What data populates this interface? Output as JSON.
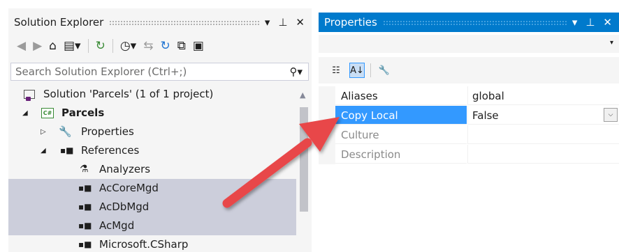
{
  "solution_explorer": {
    "title": "Solution Explorer",
    "title_buttons": {
      "dropdown": "▾",
      "pin": "⊥",
      "close": "✕"
    },
    "search": {
      "placeholder": "Search Solution Explorer (Ctrl+;)"
    },
    "tree": [
      {
        "label": "Solution 'Parcels' (1 of 1 project)",
        "icon": "solution-icon",
        "selected": false
      },
      {
        "label": "Parcels",
        "icon": "csharp-project-icon",
        "bold": true,
        "expanded": true,
        "selected": false
      },
      {
        "label": "Properties",
        "icon": "wrench-icon",
        "expanded": false,
        "selected": false
      },
      {
        "label": "References",
        "icon": "reference-icon",
        "expanded": true,
        "selected": false
      },
      {
        "label": "Analyzers",
        "icon": "analyzer-icon",
        "selected": false
      },
      {
        "label": "AcCoreMgd",
        "icon": "reference-icon",
        "selected": true
      },
      {
        "label": "AcDbMgd",
        "icon": "reference-icon",
        "selected": true
      },
      {
        "label": "AcMgd",
        "icon": "reference-icon",
        "selected": true
      },
      {
        "label": "Microsoft.CSharp",
        "icon": "reference-icon",
        "selected": false
      }
    ]
  },
  "properties": {
    "title": "Properties",
    "title_buttons": {
      "dropdown": "▾",
      "pin": "⊥",
      "close": "✕"
    },
    "rows": [
      {
        "name": "Aliases",
        "value": "global",
        "selected": false,
        "disabled": false
      },
      {
        "name": "Copy Local",
        "value": "False",
        "selected": true,
        "disabled": false,
        "has_dropdown": true
      },
      {
        "name": "Culture",
        "value": "",
        "selected": false,
        "disabled": true
      },
      {
        "name": "Description",
        "value": "",
        "selected": false,
        "disabled": true
      }
    ]
  },
  "colors": {
    "accent": "#007acc",
    "selection": "#3399ff",
    "inactive_selection": "#cccedb",
    "annotation_arrow": "#e8474a"
  }
}
